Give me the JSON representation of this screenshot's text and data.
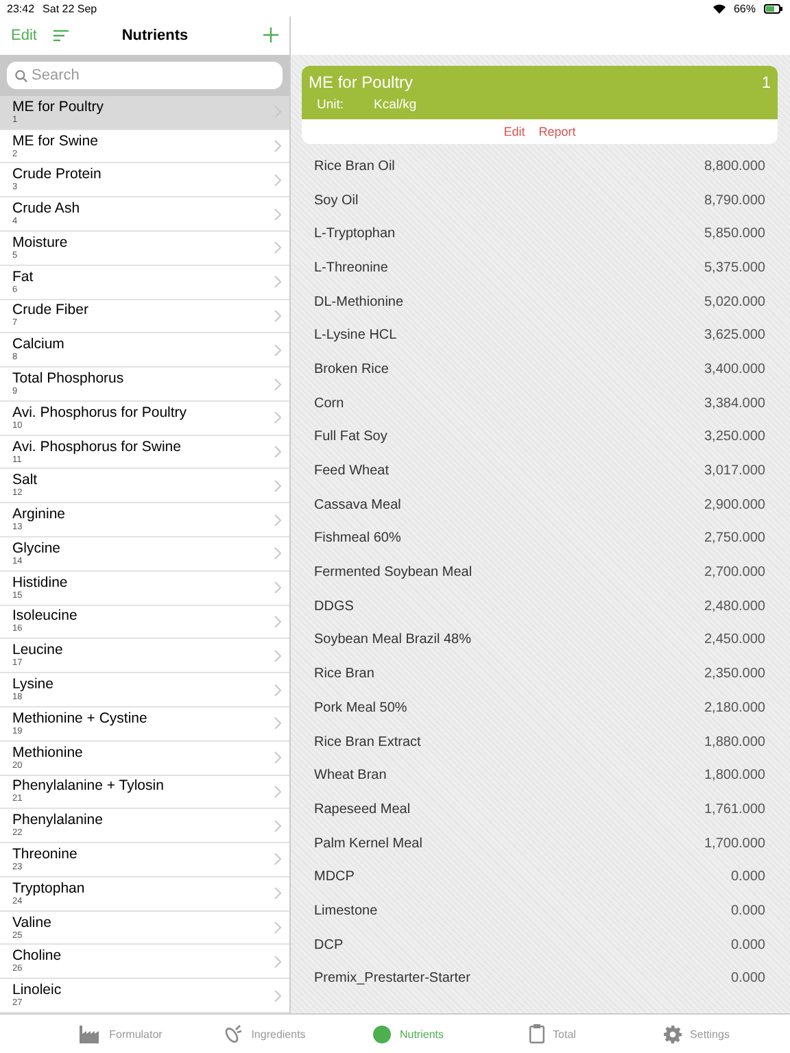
{
  "status_bar": {
    "time": "23:42",
    "date": "Sat 22 Sep",
    "battery": "66%"
  },
  "nav": {
    "edit": "Edit",
    "title": "Nutrients"
  },
  "search": {
    "placeholder": "Search"
  },
  "nutrients": [
    {
      "name": "ME for Poultry",
      "number": "1",
      "selected": true
    },
    {
      "name": "ME for Swine",
      "number": "2",
      "selected": false
    },
    {
      "name": "Crude Protein",
      "number": "3",
      "selected": false
    },
    {
      "name": "Crude Ash",
      "number": "4",
      "selected": false
    },
    {
      "name": "Moisture",
      "number": "5",
      "selected": false
    },
    {
      "name": "Fat",
      "number": "6",
      "selected": false
    },
    {
      "name": "Crude Fiber",
      "number": "7",
      "selected": false
    },
    {
      "name": "Calcium",
      "number": "8",
      "selected": false
    },
    {
      "name": "Total Phosphorus",
      "number": "9",
      "selected": false
    },
    {
      "name": "Avi. Phosphorus for Poultry",
      "number": "10",
      "selected": false
    },
    {
      "name": "Avi. Phosphorus for Swine",
      "number": "11",
      "selected": false
    },
    {
      "name": "Salt",
      "number": "12",
      "selected": false
    },
    {
      "name": "Arginine",
      "number": "13",
      "selected": false
    },
    {
      "name": "Glycine",
      "number": "14",
      "selected": false
    },
    {
      "name": "Histidine",
      "number": "15",
      "selected": false
    },
    {
      "name": "Isoleucine",
      "number": "16",
      "selected": false
    },
    {
      "name": "Leucine",
      "number": "17",
      "selected": false
    },
    {
      "name": "Lysine",
      "number": "18",
      "selected": false
    },
    {
      "name": "Methionine + Cystine",
      "number": "19",
      "selected": false
    },
    {
      "name": "Methionine",
      "number": "20",
      "selected": false
    },
    {
      "name": "Phenylalanine + Tylosin",
      "number": "21",
      "selected": false
    },
    {
      "name": "Phenylalanine",
      "number": "22",
      "selected": false
    },
    {
      "name": "Threonine",
      "number": "23",
      "selected": false
    },
    {
      "name": "Tryptophan",
      "number": "24",
      "selected": false
    },
    {
      "name": "Valine",
      "number": "25",
      "selected": false
    },
    {
      "name": "Choline",
      "number": "26",
      "selected": false
    },
    {
      "name": "Linoleic",
      "number": "27",
      "selected": false
    }
  ],
  "detail": {
    "title": "ME for Poultry",
    "number": "1",
    "unit_label": "Unit:",
    "unit": "Kcal/kg",
    "actions": [
      "Edit",
      "Report"
    ]
  },
  "ingredients": [
    {
      "name": "Rice Bran Oil",
      "value": "8,800.000"
    },
    {
      "name": "Soy Oil",
      "value": "8,790.000"
    },
    {
      "name": "L-Tryptophan",
      "value": "5,850.000"
    },
    {
      "name": "L-Threonine",
      "value": "5,375.000"
    },
    {
      "name": "DL-Methionine",
      "value": "5,020.000"
    },
    {
      "name": "L-Lysine HCL",
      "value": "3,625.000"
    },
    {
      "name": "Broken Rice",
      "value": "3,400.000"
    },
    {
      "name": "Corn",
      "value": "3,384.000"
    },
    {
      "name": "Full Fat Soy",
      "value": "3,250.000"
    },
    {
      "name": "Feed Wheat",
      "value": "3,017.000"
    },
    {
      "name": "Cassava Meal",
      "value": "2,900.000"
    },
    {
      "name": "Fishmeal 60%",
      "value": "2,750.000"
    },
    {
      "name": "Fermented Soybean Meal",
      "value": "2,700.000"
    },
    {
      "name": "DDGS",
      "value": "2,480.000"
    },
    {
      "name": "Soybean Meal Brazil 48%",
      "value": "2,450.000"
    },
    {
      "name": "Rice Bran",
      "value": "2,350.000"
    },
    {
      "name": "Pork Meal 50%",
      "value": "2,180.000"
    },
    {
      "name": "Rice Bran Extract",
      "value": "1,880.000"
    },
    {
      "name": "Wheat Bran",
      "value": "1,800.000"
    },
    {
      "name": "Rapeseed Meal",
      "value": "1,761.000"
    },
    {
      "name": "Palm Kernel Meal",
      "value": "1,700.000"
    },
    {
      "name": "MDCP",
      "value": "0.000"
    },
    {
      "name": "Limestone",
      "value": "0.000"
    },
    {
      "name": "DCP",
      "value": "0.000"
    },
    {
      "name": "Premix_Prestarter-Starter",
      "value": "0.000"
    }
  ],
  "tabs": [
    {
      "label": "Formulator",
      "kind": "factory",
      "selected": false
    },
    {
      "label": "Ingredients",
      "kind": "corn",
      "selected": false
    },
    {
      "label": "Nutrients",
      "kind": "circle",
      "selected": true
    },
    {
      "label": "Total",
      "kind": "clipboard",
      "selected": false
    },
    {
      "label": "Settings",
      "kind": "gear",
      "selected": false
    }
  ]
}
